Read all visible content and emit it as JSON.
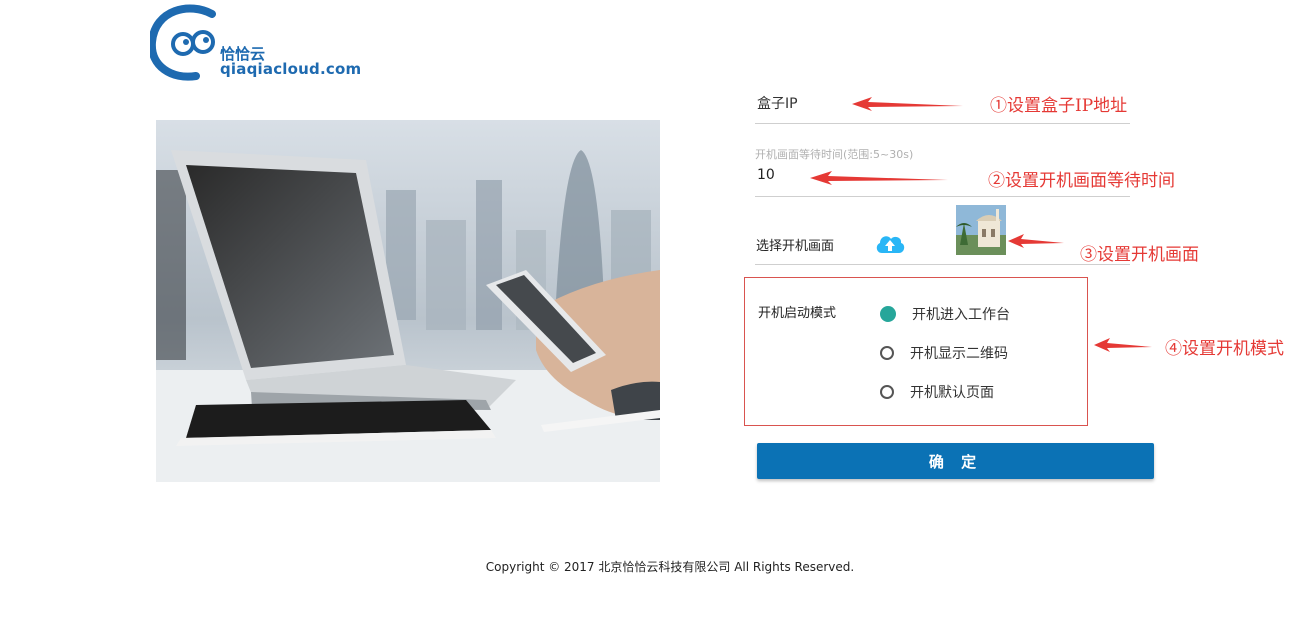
{
  "brand": {
    "name_cn": "恰恰云",
    "domain": "qiaqiacloud.com"
  },
  "form": {
    "ip_label": "盒子IP",
    "wait_hint": "开机画面等待时间(范围:5~30s)",
    "wait_value": "10",
    "select_image_label": "选择开机画面",
    "mode_label": "开机启动模式",
    "mode_options": [
      {
        "label": "开机进入工作台",
        "checked": true
      },
      {
        "label": "开机显示二维码",
        "checked": false
      },
      {
        "label": "开机默认页面",
        "checked": false
      }
    ],
    "confirm_label": "确 定"
  },
  "annotations": {
    "a1": "①设置盒子IP地址",
    "a2": "②设置开机画面等待时间",
    "a3": "③设置开机画面",
    "a4": "④设置开机模式"
  },
  "colors": {
    "accent": "#0b72b5",
    "radio_checked": "#26a69a",
    "annotation": "#e53935",
    "box_border": "#d9534f"
  },
  "icons": {
    "upload": "cloud-upload-icon"
  },
  "footer": {
    "copyright": "Copyright © 2017 北京恰恰云科技有限公司 All Rights Reserved."
  }
}
